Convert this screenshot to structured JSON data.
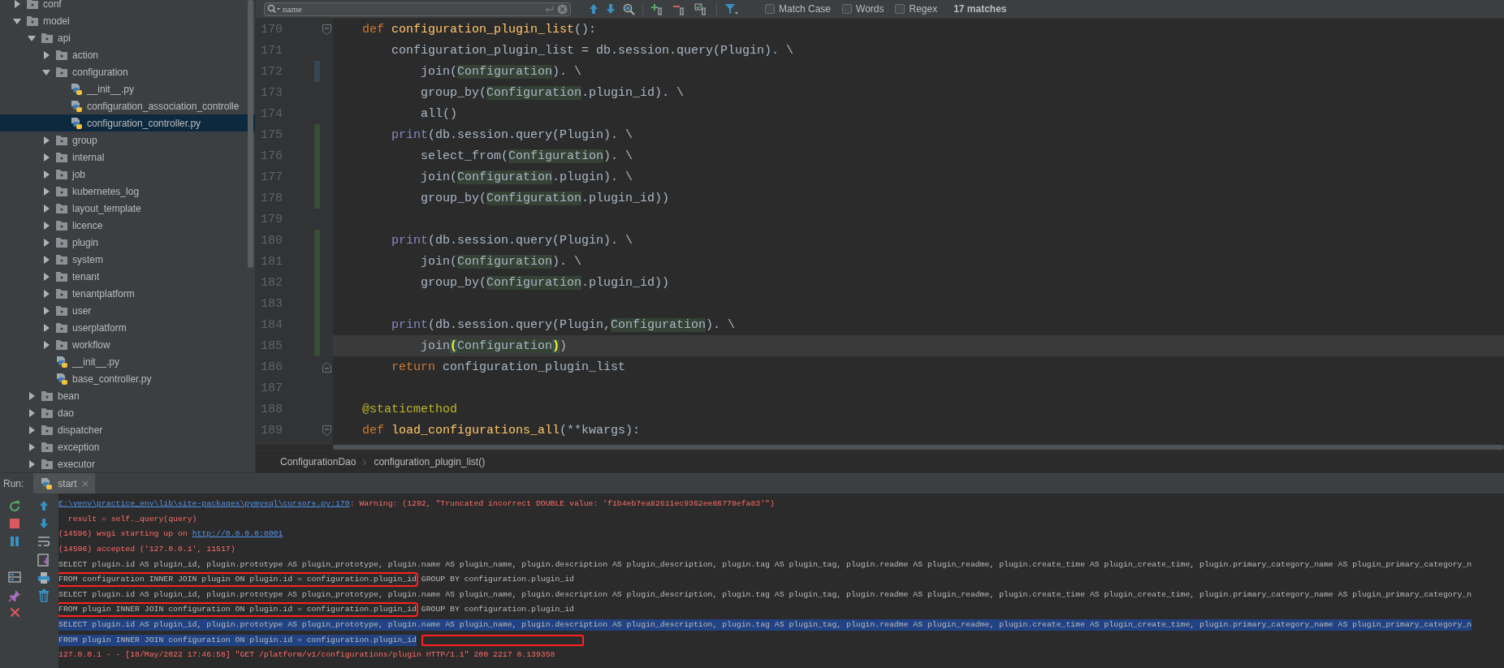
{
  "project_tree": [
    {
      "label": "conf",
      "kind": "folder",
      "expanded": false,
      "selected": false
    },
    {
      "label": "model",
      "kind": "folder",
      "expanded": true,
      "selected": false,
      "children": [
        {
          "label": "api",
          "kind": "folder",
          "expanded": true,
          "selected": false,
          "children": [
            {
              "label": "action",
              "kind": "folder",
              "expanded": false,
              "selected": false
            },
            {
              "label": "configuration",
              "kind": "folder",
              "expanded": true,
              "selected": false,
              "children": [
                {
                  "label": "__init__.py",
                  "kind": "python",
                  "selected": false
                },
                {
                  "label": "configuration_association_controlle",
                  "kind": "python",
                  "selected": false
                },
                {
                  "label": "configuration_controller.py",
                  "kind": "python",
                  "selected": true
                }
              ]
            },
            {
              "label": "group",
              "kind": "folder",
              "expanded": false,
              "selected": false
            },
            {
              "label": "internal",
              "kind": "folder",
              "expanded": false,
              "selected": false
            },
            {
              "label": "job",
              "kind": "folder",
              "expanded": false,
              "selected": false
            },
            {
              "label": "kubernetes_log",
              "kind": "folder",
              "expanded": false,
              "selected": false
            },
            {
              "label": "layout_template",
              "kind": "folder",
              "expanded": false,
              "selected": false
            },
            {
              "label": "licence",
              "kind": "folder",
              "expanded": false,
              "selected": false
            },
            {
              "label": "plugin",
              "kind": "folder",
              "expanded": false,
              "selected": false
            },
            {
              "label": "system",
              "kind": "folder",
              "expanded": false,
              "selected": false
            },
            {
              "label": "tenant",
              "kind": "folder",
              "expanded": false,
              "selected": false
            },
            {
              "label": "tenantplatform",
              "kind": "folder",
              "expanded": false,
              "selected": false
            },
            {
              "label": "user",
              "kind": "folder",
              "expanded": false,
              "selected": false
            },
            {
              "label": "userplatform",
              "kind": "folder",
              "expanded": false,
              "selected": false
            },
            {
              "label": "workflow",
              "kind": "folder",
              "expanded": false,
              "selected": false
            },
            {
              "label": "__init__.py",
              "kind": "python",
              "selected": false
            },
            {
              "label": "base_controller.py",
              "kind": "python",
              "selected": false
            }
          ]
        },
        {
          "label": "bean",
          "kind": "folder",
          "expanded": false,
          "selected": false
        },
        {
          "label": "dao",
          "kind": "folder",
          "expanded": false,
          "selected": false
        },
        {
          "label": "dispatcher",
          "kind": "folder",
          "expanded": false,
          "selected": false
        },
        {
          "label": "exception",
          "kind": "folder",
          "expanded": false,
          "selected": false
        },
        {
          "label": "executor",
          "kind": "folder",
          "expanded": false,
          "selected": false
        }
      ]
    }
  ],
  "find_bar": {
    "query": "name",
    "options": [
      {
        "label": "Match Case",
        "checked": false
      },
      {
        "label": "Words",
        "checked": false
      },
      {
        "label": "Regex",
        "checked": false
      }
    ],
    "match_count": "17 matches"
  },
  "editor": {
    "lines": [
      {
        "number": "170",
        "fold_start": true,
        "tokens": [
          {
            "kind": "keyword",
            "text": "    def"
          },
          {
            "kind": "function",
            "text": " configuration_plugin_list"
          },
          {
            "kind": "plain",
            "text": "():"
          }
        ]
      },
      {
        "number": "171",
        "tokens": [
          {
            "kind": "plain",
            "text": "        configuration_plugin_list = db.session.query(Plugin). \\"
          }
        ]
      },
      {
        "number": "172",
        "modified": true,
        "tokens": [
          {
            "kind": "plain",
            "text": "            join("
          },
          {
            "kind": "usage",
            "text": "Configuration"
          },
          {
            "kind": "plain",
            "text": "). \\"
          }
        ]
      },
      {
        "number": "173",
        "tokens": [
          {
            "kind": "plain",
            "text": "            group_by("
          },
          {
            "kind": "usage",
            "text": "Configuration"
          },
          {
            "kind": "plain",
            "text": ".plugin_id). \\"
          }
        ]
      },
      {
        "number": "174",
        "tokens": [
          {
            "kind": "plain",
            "text": "            all()"
          }
        ]
      },
      {
        "number": "175",
        "added": true,
        "tokens": [
          {
            "kind": "builtin",
            "text": "        print"
          },
          {
            "kind": "plain",
            "text": "(db.session.query(Plugin). \\"
          }
        ]
      },
      {
        "number": "176",
        "added": true,
        "tokens": [
          {
            "kind": "plain",
            "text": "            select_from("
          },
          {
            "kind": "usage",
            "text": "Configuration"
          },
          {
            "kind": "plain",
            "text": "). \\"
          }
        ]
      },
      {
        "number": "177",
        "added": true,
        "tokens": [
          {
            "kind": "plain",
            "text": "            join("
          },
          {
            "kind": "usage",
            "text": "Configuration"
          },
          {
            "kind": "plain",
            "text": ".plugin). \\"
          }
        ]
      },
      {
        "number": "178",
        "added": true,
        "tokens": [
          {
            "kind": "plain",
            "text": "            group_by("
          },
          {
            "kind": "usage",
            "text": "Configuration"
          },
          {
            "kind": "plain",
            "text": ".plugin_id))"
          }
        ]
      },
      {
        "number": "179"
      },
      {
        "number": "180",
        "added": true,
        "tokens": [
          {
            "kind": "builtin",
            "text": "        print"
          },
          {
            "kind": "plain",
            "text": "(db.session.query(Plugin). \\"
          }
        ]
      },
      {
        "number": "181",
        "added": true,
        "tokens": [
          {
            "kind": "plain",
            "text": "            join("
          },
          {
            "kind": "usage",
            "text": "Configuration"
          },
          {
            "kind": "plain",
            "text": "). \\"
          }
        ]
      },
      {
        "number": "182",
        "added": true,
        "tokens": [
          {
            "kind": "plain",
            "text": "            group_by("
          },
          {
            "kind": "usage",
            "text": "Configuration"
          },
          {
            "kind": "plain",
            "text": ".plugin_id))"
          }
        ]
      },
      {
        "number": "183",
        "added": true
      },
      {
        "number": "184",
        "added": true,
        "tokens": [
          {
            "kind": "builtin",
            "text": "        print"
          },
          {
            "kind": "plain",
            "text": "(db.session.query(Plugin,"
          },
          {
            "kind": "usage",
            "text": "Configuration"
          },
          {
            "kind": "plain",
            "text": "). \\"
          }
        ]
      },
      {
        "number": "185",
        "added": true,
        "current": true,
        "tokens": [
          {
            "kind": "plain",
            "text": "            join"
          },
          {
            "kind": "brace",
            "text": "("
          },
          {
            "kind": "usage",
            "text": "Configuration"
          },
          {
            "kind": "brace",
            "text": ")"
          },
          {
            "kind": "plain",
            "text": ")"
          }
        ]
      },
      {
        "number": "186",
        "fold_end": true,
        "tokens": [
          {
            "kind": "keyword",
            "text": "        return"
          },
          {
            "kind": "plain",
            "text": " configuration_plugin_list"
          }
        ]
      },
      {
        "number": "187"
      },
      {
        "number": "188",
        "tokens": [
          {
            "kind": "decorator",
            "text": "    @staticmethod"
          }
        ]
      },
      {
        "number": "189",
        "fold_start": true,
        "tokens": [
          {
            "kind": "keyword",
            "text": "    def"
          },
          {
            "kind": "function",
            "text": " load_configurations_all"
          },
          {
            "kind": "plain",
            "text": "(**kwargs):"
          }
        ]
      }
    ]
  },
  "breadcrumb": [
    "ConfigurationDao",
    "configuration_plugin_list()"
  ],
  "run_panel": {
    "label": "Run:",
    "tabs": [
      {
        "label": "start",
        "selected": true
      }
    ],
    "console": [
      {
        "error": true,
        "selected": false,
        "segments": [
          {
            "kind": "link",
            "text": "E:\\venv\\practice_env\\lib\\site-packages\\pymysql\\cursors.py:170",
            "boxed": false
          },
          {
            "kind": "text",
            "text": ": Warning: (1292, \"Truncated incorrect DOUBLE value: 'f1b4eb7ea82611ec9362ee86778efa83'\")",
            "boxed": false
          }
        ]
      },
      {
        "error": true,
        "selected": false,
        "segments": [
          {
            "kind": "text",
            "text": "  result = self._query(query)",
            "boxed": false
          }
        ]
      },
      {
        "error": true,
        "selected": false,
        "segments": [
          {
            "kind": "text",
            "text": "(14596) wsgi starting up on ",
            "boxed": false
          },
          {
            "kind": "link",
            "text": "http://0.0.0.0:8001",
            "boxed": false
          }
        ]
      },
      {
        "error": true,
        "selected": false,
        "segments": [
          {
            "kind": "text",
            "text": "(14596) accepted ('127.0.0.1', 11517)",
            "boxed": false
          }
        ]
      },
      {
        "error": false,
        "selected": false,
        "segments": [
          {
            "kind": "text",
            "text": "SELECT plugin.id AS plugin_id, plugin.prototype AS plugin_prototype, plugin.name AS plugin_name, plugin.description AS plugin_description, plugin.tag AS plugin_tag, plugin.readme AS plugin_readme, plugin.create_time AS plugin_create_time, plugin.primary_category_name AS plugin_primary_category_n",
            "boxed": false
          }
        ]
      },
      {
        "error": false,
        "selected": false,
        "segments": [
          {
            "kind": "text",
            "text": "FROM configuration INNER JOIN plugin ON plugin.id = configuration.plugin_id",
            "boxed": true
          },
          {
            "kind": "text",
            "text": " GROUP BY configuration.plugin_id",
            "boxed": false
          }
        ]
      },
      {
        "error": false,
        "selected": false,
        "segments": [
          {
            "kind": "text",
            "text": "SELECT plugin.id AS plugin_id, plugin.prototype AS plugin_prototype, plugin.name AS plugin_name, plugin.description AS plugin_description, plugin.tag AS plugin_tag, plugin.readme AS plugin_readme, plugin.create_time AS plugin_create_time, plugin.primary_category_name AS plugin_primary_category_n",
            "boxed": false
          }
        ]
      },
      {
        "error": false,
        "selected": false,
        "segments": [
          {
            "kind": "text",
            "text": "FROM plugin INNER JOIN configuration ON plugin.id = configuration.plugin_id",
            "boxed": true
          },
          {
            "kind": "text",
            "text": " GROUP BY configuration.plugin_id",
            "boxed": false
          }
        ]
      },
      {
        "error": false,
        "selected": true,
        "segments": [
          {
            "kind": "text",
            "text": "SELECT plugin.id AS plugin_id, plugin.prototype AS plugin_prototype, plugin.name AS plugin_name, plugin.description AS plugin_description, plugin.tag AS plugin_tag, plugin.readme AS plugin_readme, plugin.create_time AS plugin_create_time, plugin.primary_category_name AS plugin_primary_category_n",
            "boxed": false
          }
        ]
      },
      {
        "error": false,
        "selected": true,
        "annotation_box": true,
        "segments": [
          {
            "kind": "text",
            "text": "FROM plugin INNER JOIN configuration ON plugin.id = configuration.plugin_id",
            "boxed": false
          }
        ]
      },
      {
        "error": true,
        "selected": false,
        "segments": [
          {
            "kind": "text",
            "text": "127.0.0.1 - - [18/May/2022 17:46:58] \"GET /platform/v1/configurations/plugin HTTP/1.1\" 200 2217 0.139358",
            "boxed": false
          }
        ]
      }
    ]
  }
}
